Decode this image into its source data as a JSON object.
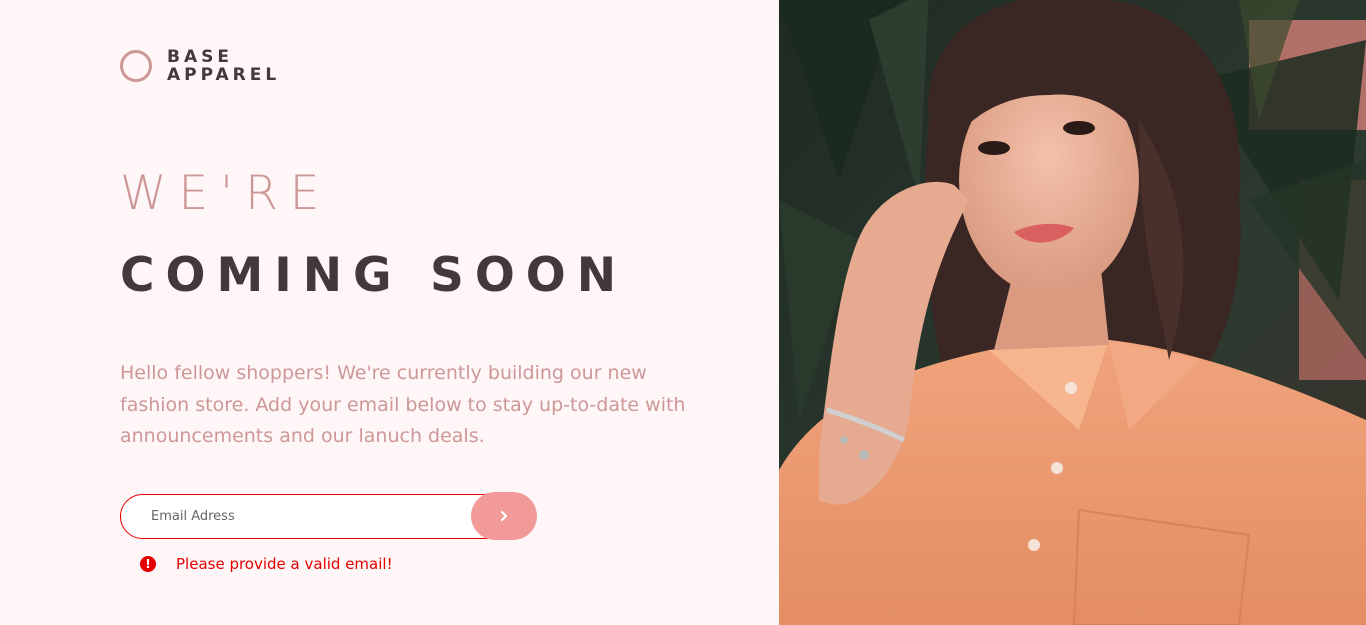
{
  "logo": {
    "line1": "BASE",
    "line2": "APPAREL"
  },
  "headline": {
    "line1": "WE'RE",
    "line2": "COMING SOON"
  },
  "description": "Hello fellow shoppers! We're currently building our new fashion store. Add your email below to stay up-to-date with announcements and our lanuch deals.",
  "form": {
    "email_value": "",
    "email_placeholder": "Email Adress",
    "submit_icon": "chevron-right-icon"
  },
  "error": {
    "icon": "exclamation-icon",
    "icon_glyph": "!",
    "message": "Please provide a valid email!"
  },
  "colors": {
    "accent": "#ce9797",
    "dark_text": "#423a3a",
    "error": "#e50000",
    "button": "#f29a9a",
    "background": "#fff7f7"
  }
}
